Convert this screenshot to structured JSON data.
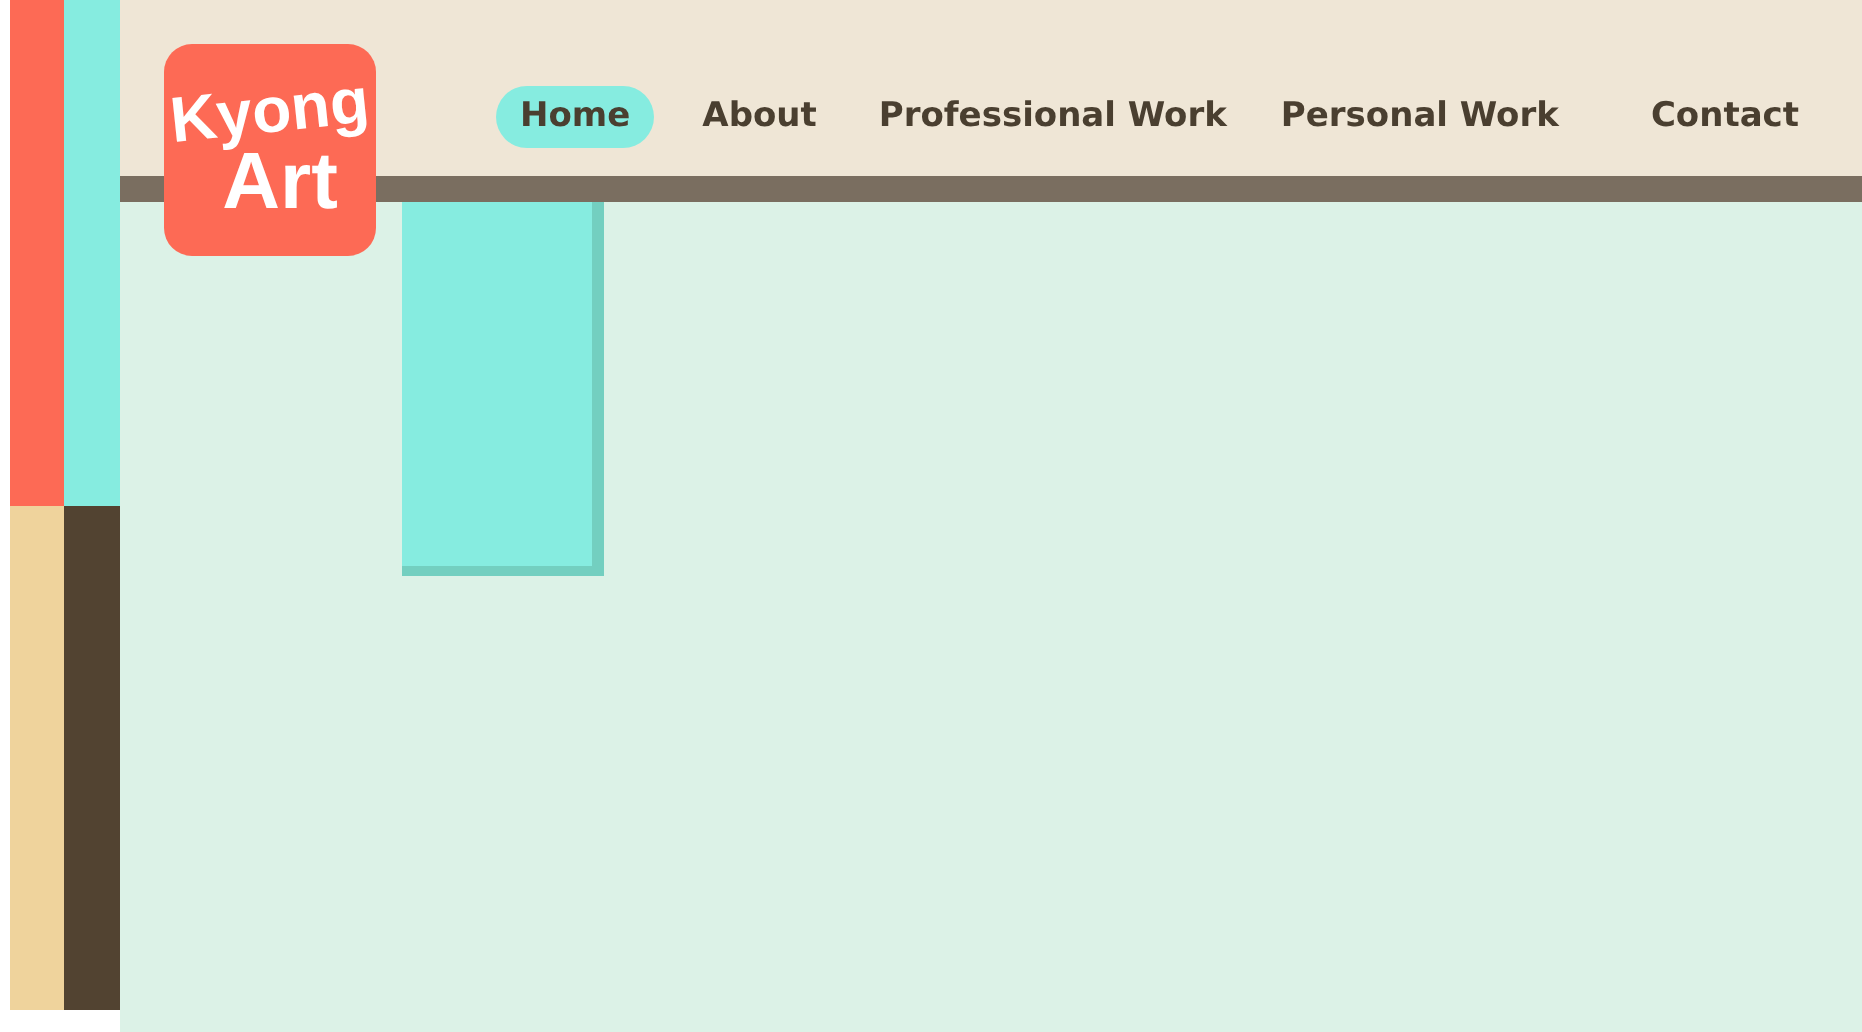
{
  "logo": {
    "lines": [
      "Kyong",
      "Art"
    ]
  },
  "nav": [
    {
      "label": "Home",
      "selected": true
    },
    {
      "label": "About",
      "selected": false
    },
    {
      "label": "Professional Work",
      "selected": false
    },
    {
      "label": "Personal Work",
      "selected": false
    },
    {
      "label": "Contact",
      "selected": false
    }
  ]
}
